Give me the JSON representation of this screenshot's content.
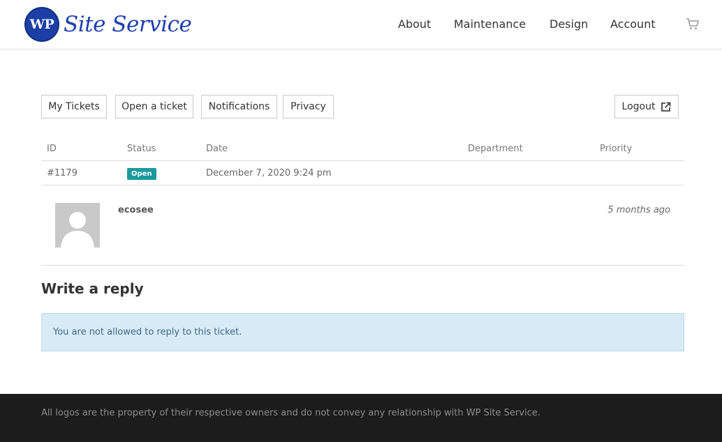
{
  "site": {
    "logo_badge": "WP",
    "logo_text": "Site Service"
  },
  "nav": {
    "items": [
      "About",
      "Maintenance",
      "Design",
      "Account"
    ],
    "cart_icon": "cart-icon"
  },
  "ticket_menu": {
    "buttons": [
      "My Tickets",
      "Open a ticket",
      "Notifications",
      "Privacy"
    ],
    "logout_label": "Logout",
    "logout_icon": "external-link-icon"
  },
  "table": {
    "headers": [
      "ID",
      "Status",
      "Date",
      "Department",
      "Priority"
    ],
    "row": {
      "id": "#1179",
      "status": "Open",
      "date": "December 7, 2020 9:24 pm",
      "department": "",
      "priority": ""
    }
  },
  "reply_entry": {
    "author": "ecosee",
    "time_ago": "5 months ago"
  },
  "reply_section": {
    "title": "Write a reply",
    "notice": "You are not allowed to reply to this ticket."
  },
  "footer": {
    "text": "All logos are the property of their respective owners and do not convey any relationship with WP Site Service."
  },
  "colors": {
    "brand_blue": "#1d3fb0",
    "status_open": "#1a9a9e",
    "notice_bg": "#d7eaf6",
    "footer_bg": "#1c1c1c"
  }
}
